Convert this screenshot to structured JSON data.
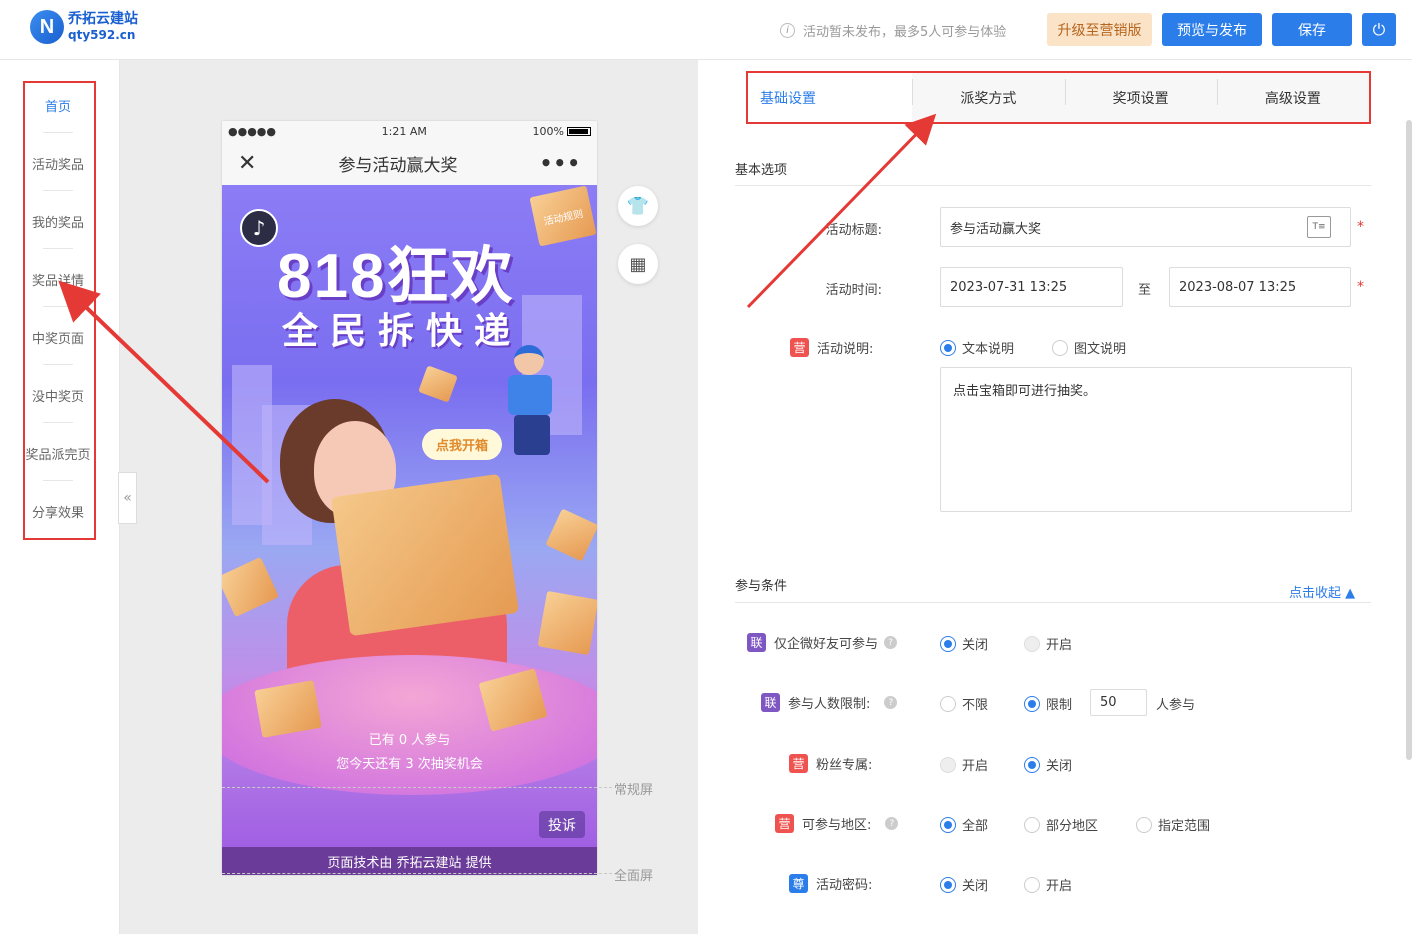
{
  "header": {
    "logo_name": "乔拓云建站",
    "logo_url": "qty592.cn",
    "logo_mark": "N",
    "notice": "活动暂未发布，最多5人可参与体验",
    "upgrade_label": "升级至营销版",
    "preview_label": "预览与发布",
    "save_label": "保存",
    "power_icon": "⏻"
  },
  "sidebar": {
    "items": [
      {
        "label": "首页"
      },
      {
        "label": "活动奖品"
      },
      {
        "label": "我的奖品"
      },
      {
        "label": "奖品详情"
      },
      {
        "label": "中奖页面"
      },
      {
        "label": "没中奖页"
      },
      {
        "label": "奖品派完页"
      },
      {
        "label": "分享效果"
      }
    ],
    "collapse_icon": "«"
  },
  "phone": {
    "signal": "●●●●●",
    "time": "1:21 AM",
    "battery": "100%",
    "title": "参与活动赢大奖",
    "close_icon": "✕",
    "more_icon": "•••",
    "headline": "818狂欢",
    "subline": "全民拆快递",
    "bubble": "点我开箱",
    "participants": "已有 0 人参与",
    "chances": "您今天还有 3 次抽奖机会",
    "complain": "投诉",
    "footer": "页面技术由 乔拓云建站 提供",
    "music_icon": "♪",
    "box_label": "活动规则"
  },
  "canvas": {
    "normal_screen": "常规屏",
    "full_screen": "全面屏",
    "shirt_icon": "👕",
    "grid_icon": "▦"
  },
  "tabs": [
    {
      "label": "基础设置"
    },
    {
      "label": "派奖方式"
    },
    {
      "label": "奖项设置"
    },
    {
      "label": "高级设置"
    }
  ],
  "basic": {
    "section": "基本选项",
    "title_label": "活动标题:",
    "title_value": "参与活动赢大奖",
    "time_label": "活动时间:",
    "time_start": "2023-07-31 13:25",
    "time_to": "至",
    "time_end": "2023-08-07 13:25",
    "desc_label": "活动说明:",
    "desc_opt1": "文本说明",
    "desc_opt2": "图文说明",
    "desc_text": "点击宝箱即可进行抽奖。",
    "tag_ying": "营"
  },
  "conditions": {
    "section": "参与条件",
    "collapse_label": "点击收起 ▲",
    "tag_lian": "联",
    "tag_ying": "营",
    "tag_zun": "尊",
    "wecom_label": "仅企微好友可参与",
    "wecom_off": "关闭",
    "wecom_on": "开启",
    "limit_label": "参与人数限制:",
    "limit_none": "不限",
    "limit_on": "限制",
    "limit_value": "50",
    "limit_unit": "人参与",
    "fans_label": "粉丝专属:",
    "fans_on": "开启",
    "fans_off": "关闭",
    "region_label": "可参与地区:",
    "region_all": "全部",
    "region_part": "部分地区",
    "region_range": "指定范围",
    "pwd_label": "活动密码:",
    "pwd_off": "关闭",
    "pwd_on": "开启"
  },
  "colors": {
    "accent": "#2b7de9",
    "highlight_box": "#e53935"
  }
}
